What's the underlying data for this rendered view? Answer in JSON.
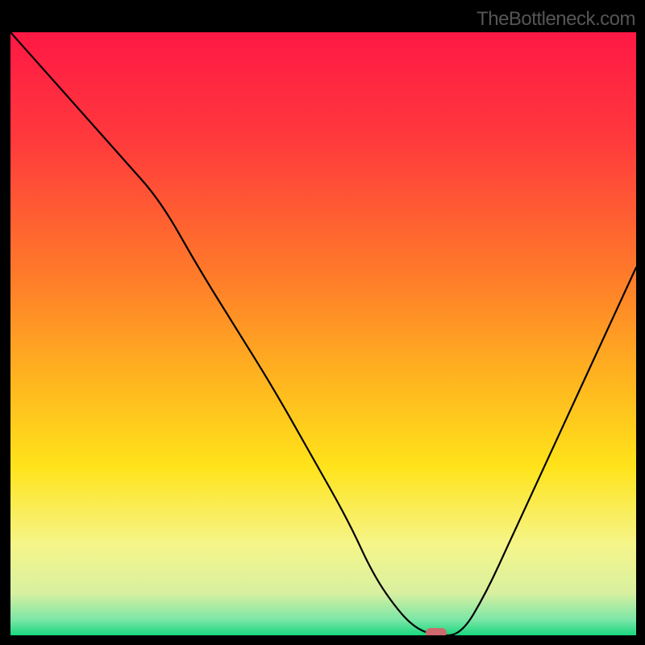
{
  "watermark": "TheBottleneck.com",
  "chart_data": {
    "type": "line",
    "title": "",
    "xlabel": "",
    "ylabel": "",
    "xlim": [
      0,
      100
    ],
    "ylim": [
      0,
      100
    ],
    "gradient_stops": [
      {
        "pos": 0.0,
        "color": "#ff1845"
      },
      {
        "pos": 0.18,
        "color": "#ff3a3c"
      },
      {
        "pos": 0.4,
        "color": "#ff7a2a"
      },
      {
        "pos": 0.58,
        "color": "#ffb61f"
      },
      {
        "pos": 0.72,
        "color": "#ffe31a"
      },
      {
        "pos": 0.85,
        "color": "#f5f58a"
      },
      {
        "pos": 0.93,
        "color": "#d8f0a0"
      },
      {
        "pos": 0.975,
        "color": "#79e6a6"
      },
      {
        "pos": 1.0,
        "color": "#19d77e"
      }
    ],
    "x": [
      0,
      6,
      12,
      18,
      24,
      30,
      36,
      42,
      48,
      54,
      58,
      62,
      65,
      68,
      72,
      76,
      80,
      84,
      88,
      92,
      96,
      100
    ],
    "values": [
      100,
      93,
      86,
      79,
      72,
      61,
      51,
      41,
      30,
      19,
      10,
      4,
      1,
      0,
      0,
      7,
      16,
      25,
      34,
      43,
      52,
      61
    ],
    "optimal_marker": {
      "x": 68,
      "y": 0
    }
  }
}
